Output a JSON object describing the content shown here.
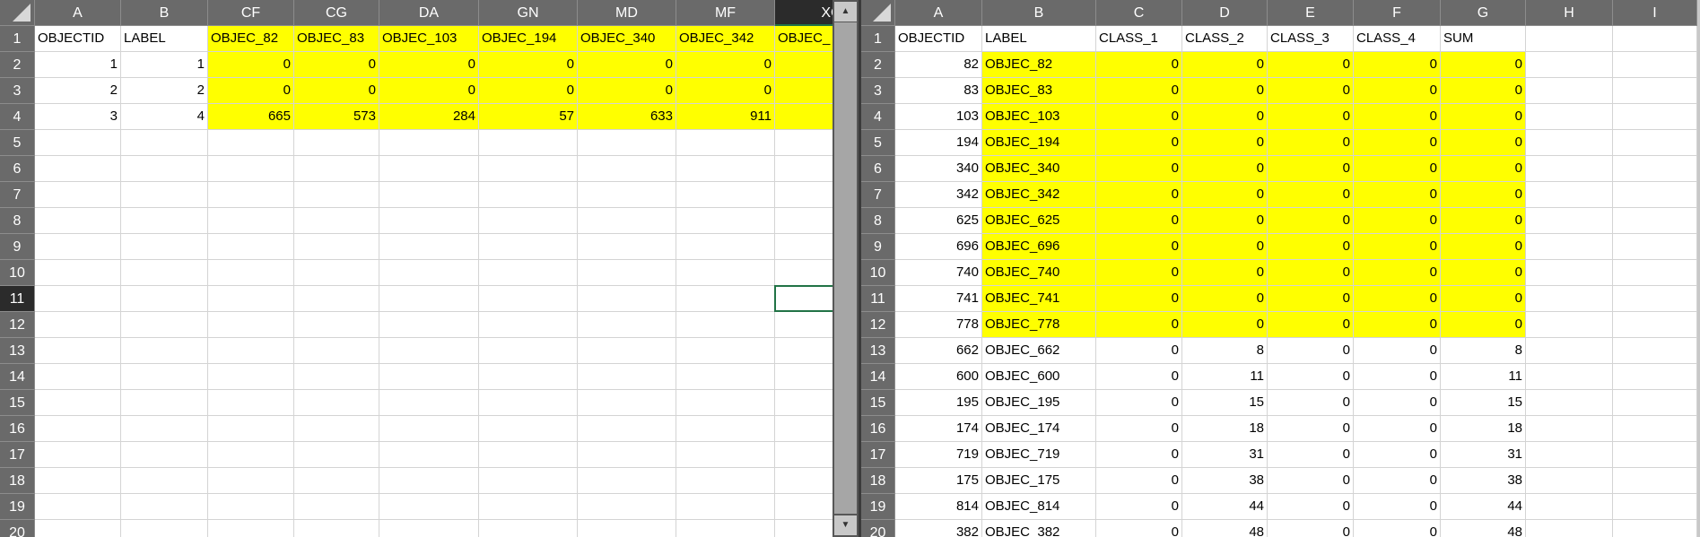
{
  "left_sheet": {
    "columns": [
      "A",
      "B",
      "CF",
      "CG",
      "DA",
      "GN",
      "MD",
      "MF",
      "XC"
    ],
    "selected_column": "XC",
    "selected_row": 11,
    "row_count": 20,
    "rows": [
      [
        "OBJECTID",
        "LABEL",
        "OBJEC_82",
        "OBJEC_83",
        "OBJEC_103",
        "OBJEC_194",
        "OBJEC_340",
        "OBJEC_342",
        "OBJEC_"
      ],
      [
        "1",
        "1",
        "0",
        "0",
        "0",
        "0",
        "0",
        "0",
        ""
      ],
      [
        "2",
        "2",
        "0",
        "0",
        "0",
        "0",
        "0",
        "0",
        ""
      ],
      [
        "3",
        "4",
        "665",
        "573",
        "284",
        "57",
        "633",
        "911",
        ""
      ]
    ],
    "highlight_color": "#ffff00"
  },
  "scrollbar": {
    "up_icon": "▲",
    "down_icon": "▼"
  },
  "right_sheet": {
    "columns": [
      "A",
      "B",
      "C",
      "D",
      "E",
      "F",
      "G",
      "H",
      "I"
    ],
    "row_count": 20,
    "rows": [
      [
        "OBJECTID",
        "LABEL",
        "CLASS_1",
        "CLASS_2",
        "CLASS_3",
        "CLASS_4",
        "SUM"
      ],
      [
        "82",
        "OBJEC_82",
        "0",
        "0",
        "0",
        "0",
        "0"
      ],
      [
        "83",
        "OBJEC_83",
        "0",
        "0",
        "0",
        "0",
        "0"
      ],
      [
        "103",
        "OBJEC_103",
        "0",
        "0",
        "0",
        "0",
        "0"
      ],
      [
        "194",
        "OBJEC_194",
        "0",
        "0",
        "0",
        "0",
        "0"
      ],
      [
        "340",
        "OBJEC_340",
        "0",
        "0",
        "0",
        "0",
        "0"
      ],
      [
        "342",
        "OBJEC_342",
        "0",
        "0",
        "0",
        "0",
        "0"
      ],
      [
        "625",
        "OBJEC_625",
        "0",
        "0",
        "0",
        "0",
        "0"
      ],
      [
        "696",
        "OBJEC_696",
        "0",
        "0",
        "0",
        "0",
        "0"
      ],
      [
        "740",
        "OBJEC_740",
        "0",
        "0",
        "0",
        "0",
        "0"
      ],
      [
        "741",
        "OBJEC_741",
        "0",
        "0",
        "0",
        "0",
        "0"
      ],
      [
        "778",
        "OBJEC_778",
        "0",
        "0",
        "0",
        "0",
        "0"
      ],
      [
        "662",
        "OBJEC_662",
        "0",
        "8",
        "0",
        "0",
        "8"
      ],
      [
        "600",
        "OBJEC_600",
        "0",
        "11",
        "0",
        "0",
        "11"
      ],
      [
        "195",
        "OBJEC_195",
        "0",
        "15",
        "0",
        "0",
        "15"
      ],
      [
        "174",
        "OBJEC_174",
        "0",
        "18",
        "0",
        "0",
        "18"
      ],
      [
        "719",
        "OBJEC_719",
        "0",
        "31",
        "0",
        "0",
        "31"
      ],
      [
        "175",
        "OBJEC_175",
        "0",
        "38",
        "0",
        "0",
        "38"
      ],
      [
        "814",
        "OBJEC_814",
        "0",
        "44",
        "0",
        "0",
        "44"
      ],
      [
        "382",
        "OBJEC_382",
        "0",
        "48",
        "0",
        "0",
        "48"
      ]
    ],
    "highlight_color": "#ffff00"
  }
}
